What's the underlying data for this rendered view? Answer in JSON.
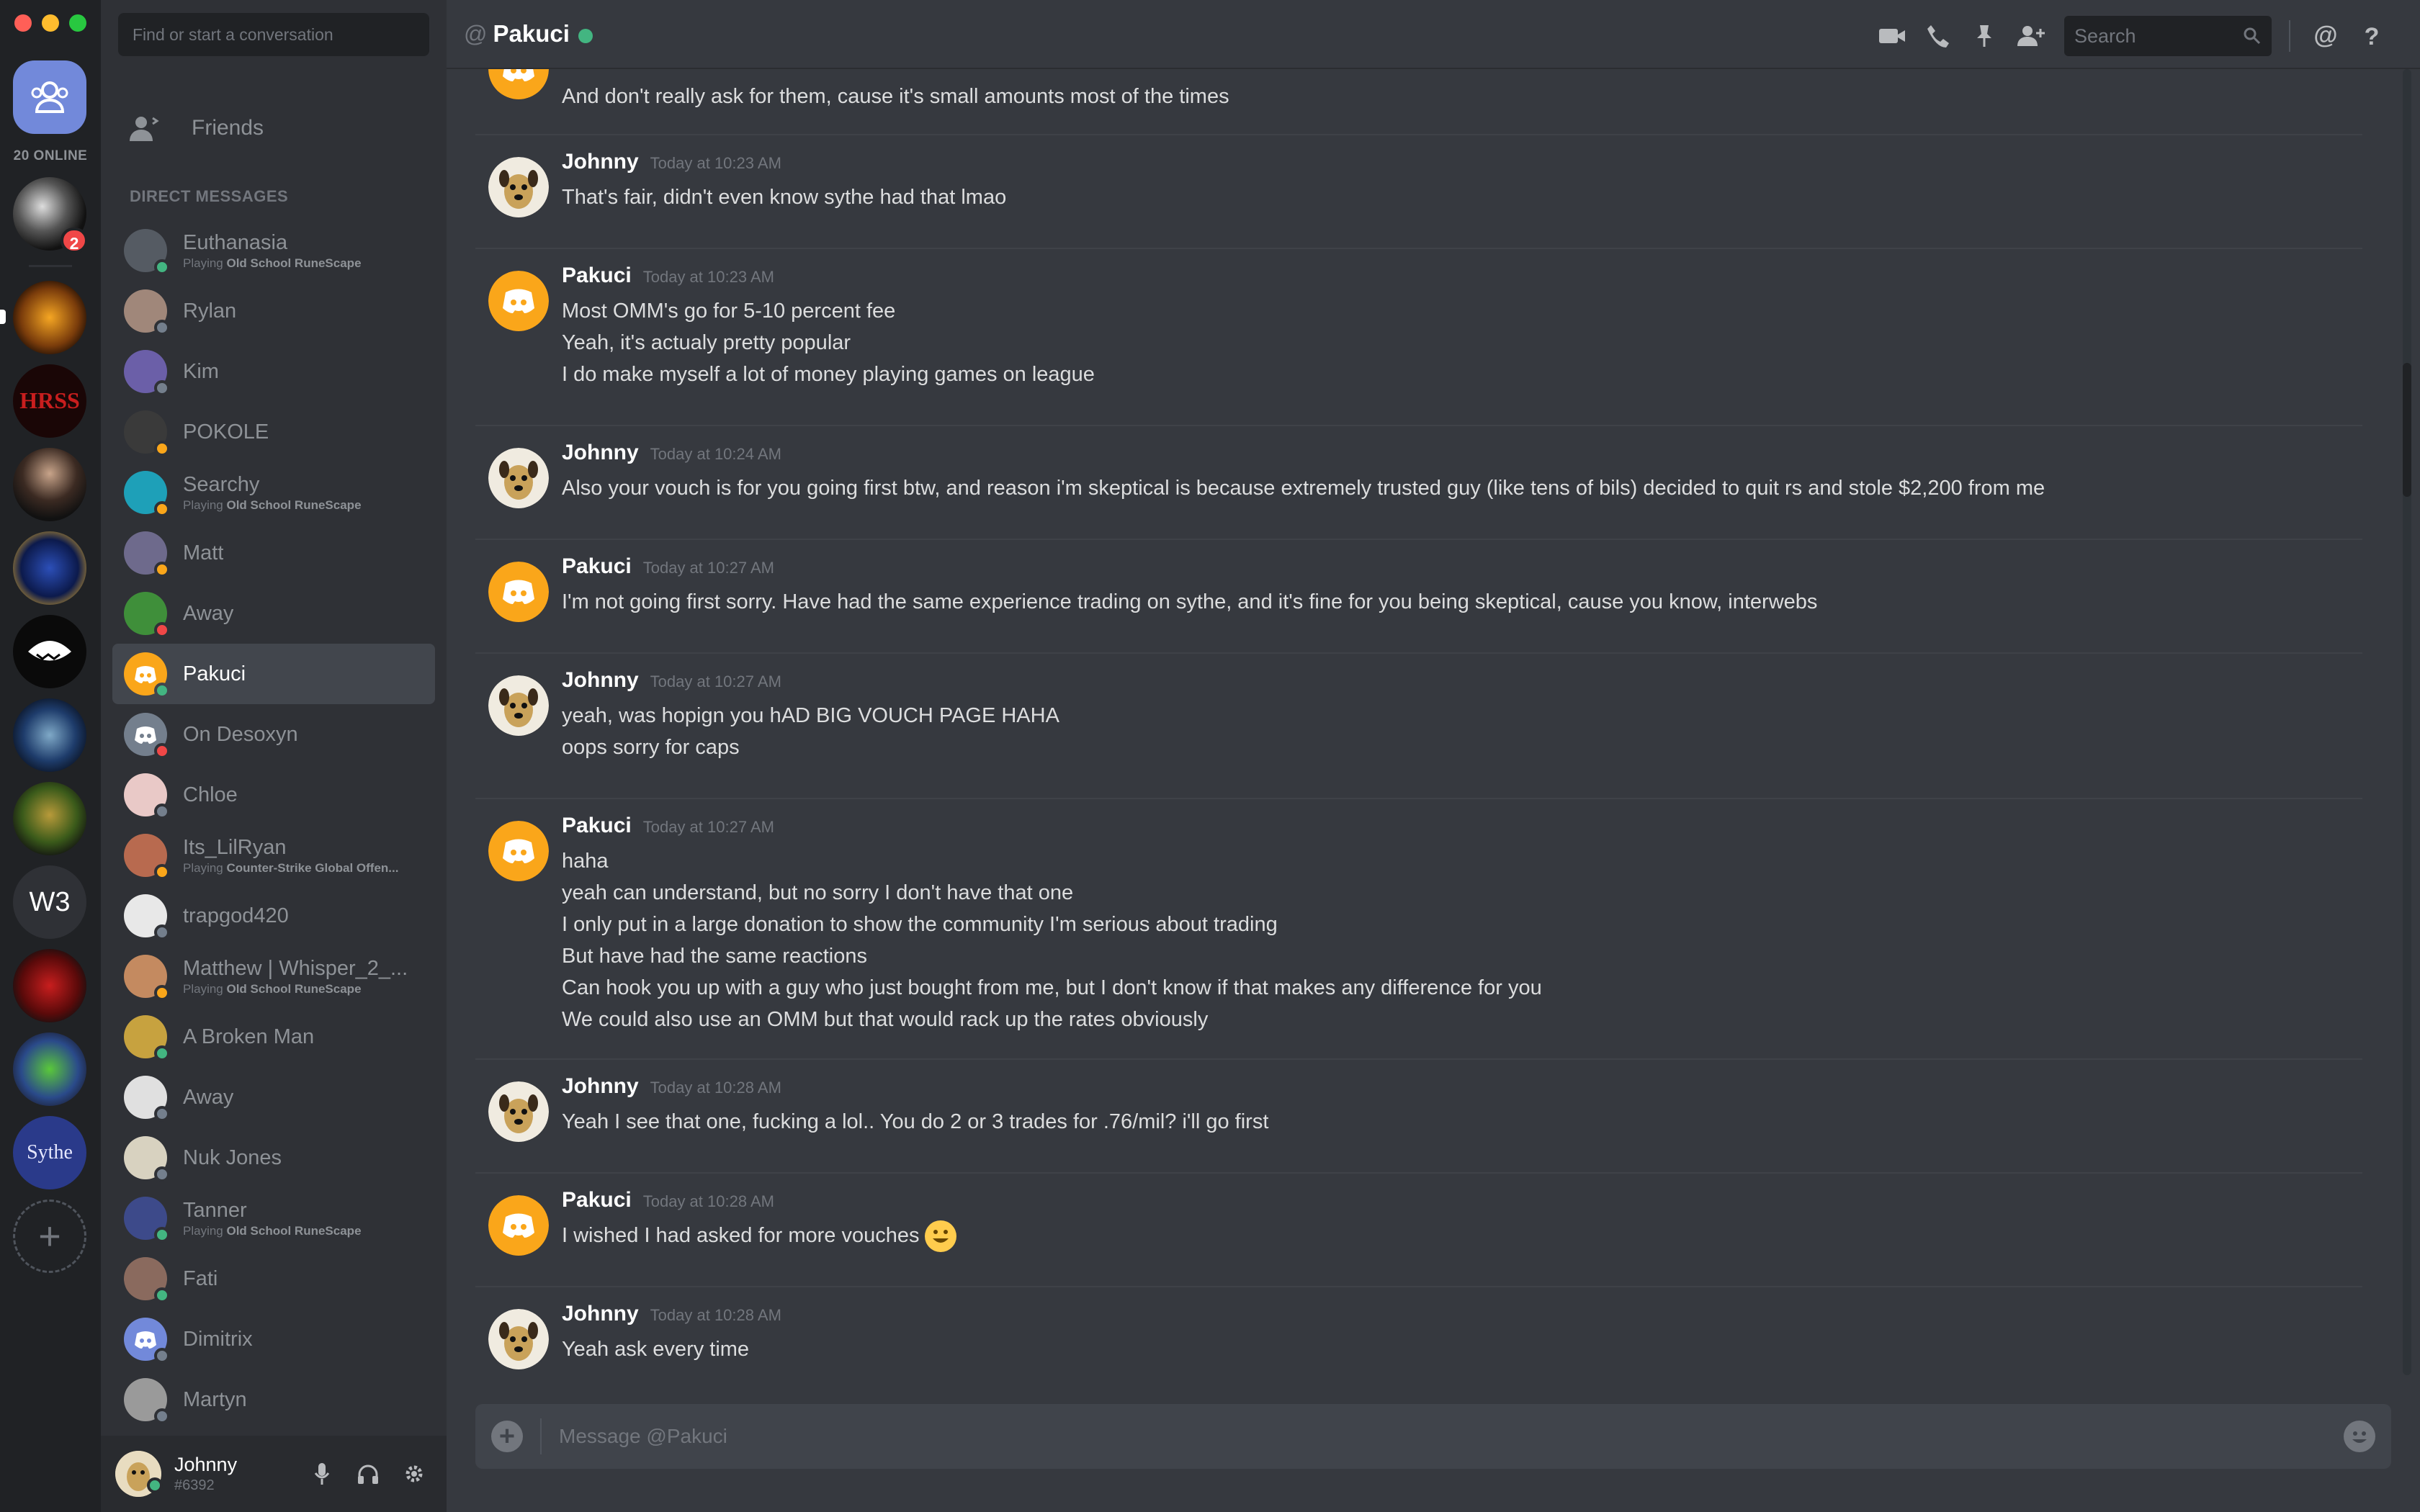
{
  "window": {
    "title": "Pakuci"
  },
  "server_rail": {
    "online_count": "20 ONLINE",
    "mention_badge": "2",
    "text_server": "W3",
    "sythe_label": "Sythe"
  },
  "sidebar": {
    "find_placeholder": "Find or start a conversation",
    "friends_label": "Friends",
    "dm_header": "DIRECT MESSAGES",
    "dms": [
      {
        "name": "Euthanasia",
        "activity_prefix": "Playing ",
        "activity": "Old School RuneScape",
        "status": "on",
        "color": "#555b63"
      },
      {
        "name": "Rylan",
        "activity_prefix": "",
        "activity": "",
        "status": "off",
        "color": "#a0877a"
      },
      {
        "name": "Kim",
        "activity_prefix": "",
        "activity": "",
        "status": "off",
        "color": "#6b5fa8"
      },
      {
        "name": "POKOLE",
        "activity_prefix": "",
        "activity": "",
        "status": "idle",
        "color": "#3a3a3a"
      },
      {
        "name": "Searchy",
        "activity_prefix": "Playing ",
        "activity": "Old School RuneScape",
        "status": "idle",
        "color": "#1ea0b8"
      },
      {
        "name": "Matt",
        "activity_prefix": "",
        "activity": "",
        "status": "idle",
        "color": "#6e6a8c"
      },
      {
        "name": "Away",
        "activity_prefix": "",
        "activity": "",
        "status": "dnd",
        "color": "#3f8f3a"
      },
      {
        "name": "Pakuci",
        "activity_prefix": "",
        "activity": "",
        "status": "on",
        "color": "#faa61a"
      },
      {
        "name": "On Desoxyn",
        "activity_prefix": "",
        "activity": "",
        "status": "dnd",
        "color": "#747f8d"
      },
      {
        "name": "Chloe",
        "activity_prefix": "",
        "activity": "",
        "status": "off",
        "color": "#e9c9c7"
      },
      {
        "name": "Its_LilRyan",
        "activity_prefix": "Playing ",
        "activity": "Counter-Strike Global Offen...",
        "status": "idle",
        "color": "#b86a4f"
      },
      {
        "name": "trapgod420",
        "activity_prefix": "",
        "activity": "",
        "status": "off",
        "color": "#e8e8e8"
      },
      {
        "name": "Matthew | Whisper_2_...",
        "activity_prefix": "Playing ",
        "activity": "Old School RuneScape",
        "status": "idle",
        "color": "#c48a60"
      },
      {
        "name": "A Broken Man",
        "activity_prefix": "",
        "activity": "",
        "status": "on",
        "color": "#c7a23f"
      },
      {
        "name": "Away",
        "activity_prefix": "",
        "activity": "",
        "status": "off",
        "color": "#e0e0e0"
      },
      {
        "name": "Nuk Jones",
        "activity_prefix": "",
        "activity": "",
        "status": "off",
        "color": "#d8d2c0"
      },
      {
        "name": "Tanner",
        "activity_prefix": "Playing ",
        "activity": "Old School RuneScape",
        "status": "on",
        "color": "#3d4a8a"
      },
      {
        "name": "Fati",
        "activity_prefix": "",
        "activity": "",
        "status": "on",
        "color": "#8a6a5e"
      },
      {
        "name": "Dimitrix",
        "activity_prefix": "",
        "activity": "",
        "status": "off",
        "color": "#7289da"
      },
      {
        "name": "Martyn",
        "activity_prefix": "",
        "activity": "",
        "status": "off",
        "color": "#9a9a9a"
      }
    ]
  },
  "user": {
    "name": "Johnny",
    "tag": "#6392"
  },
  "header": {
    "channel": "Pakuci",
    "search_placeholder": "Search"
  },
  "messages": [
    {
      "author": "",
      "time": "",
      "avatar": "pakuci",
      "lines": [
        "And don't really ask for them, cause it's small amounts most of the times"
      ]
    },
    {
      "author": "Johnny",
      "time": "Today at 10:23 AM",
      "avatar": "johnny",
      "lines": [
        "That's fair, didn't even know sythe had that lmao"
      ]
    },
    {
      "author": "Pakuci",
      "time": "Today at 10:23 AM",
      "avatar": "pakuci",
      "lines": [
        "Most OMM's go for 5-10 percent fee",
        "Yeah, it's actualy pretty popular",
        "I do make myself a lot of money playing games on league"
      ]
    },
    {
      "author": "Johnny",
      "time": "Today at 10:24 AM",
      "avatar": "johnny",
      "lines": [
        "Also your vouch is for you going first btw, and reason i'm skeptical is because extremely trusted guy (like tens of bils) decided to quit rs and stole $2,200 from me"
      ]
    },
    {
      "author": "Pakuci",
      "time": "Today at 10:27 AM",
      "avatar": "pakuci",
      "lines": [
        "I'm not going first sorry. Have had the same experience trading on sythe, and it's fine for you being skeptical, cause you know, interwebs"
      ]
    },
    {
      "author": "Johnny",
      "time": "Today at 10:27 AM",
      "avatar": "johnny",
      "lines": [
        "yeah, was hopign you hAD BIG VOUCH PAGE HAHA",
        "oops sorry for caps"
      ]
    },
    {
      "author": "Pakuci",
      "time": "Today at 10:27 AM",
      "avatar": "pakuci",
      "lines": [
        "haha",
        "yeah can understand, but no sorry I don't have that one",
        "I only put in a large donation to show the community I'm serious about trading",
        "But have had the same reactions",
        "Can hook you up with a guy who just bought from me, but I don't know if that makes any difference for you",
        "We could also use an OMM but that would rack up the rates obviously"
      ]
    },
    {
      "author": "Johnny",
      "time": "Today at 10:28 AM",
      "avatar": "johnny",
      "lines": [
        "Yeah I see that one, fucking a lol.. You do 2 or 3 trades for .76/mil? i'll go first"
      ]
    },
    {
      "author": "Pakuci",
      "time": "Today at 10:28 AM",
      "avatar": "pakuci",
      "lines": [
        "I wished I had asked for more vouches"
      ],
      "emoji": "smiley"
    },
    {
      "author": "Johnny",
      "time": "Today at 10:28 AM",
      "avatar": "johnny",
      "lines": [
        "Yeah ask every time"
      ]
    }
  ],
  "composer": {
    "placeholder": "Message @Pakuci"
  },
  "colors": {
    "blurple": "#7289da",
    "online": "#43b581",
    "idle": "#faa61a",
    "dnd": "#f04747",
    "offline": "#747f8d",
    "pakuci_orange": "#faa61a"
  }
}
